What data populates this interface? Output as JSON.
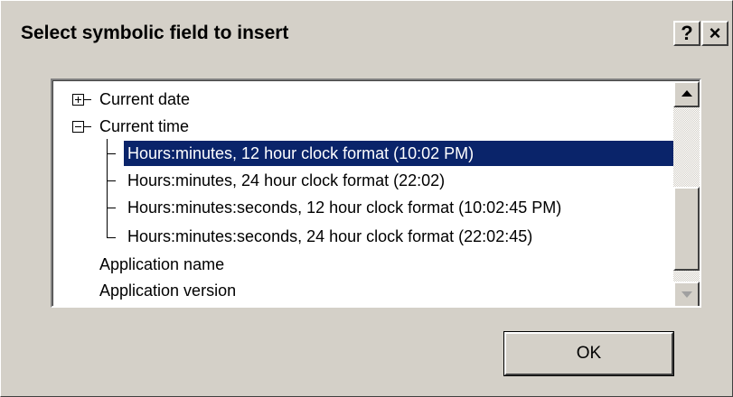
{
  "dialog": {
    "title": "Select symbolic field to insert",
    "help_button": "?",
    "close_button": "✕"
  },
  "tree": {
    "items": [
      {
        "label": "Current date",
        "expander": "plus"
      },
      {
        "label": "Current time",
        "expander": "minus"
      },
      {
        "label": "Hours:minutes, 12 hour clock format (10:02 PM)",
        "selected": true
      },
      {
        "label": "Hours:minutes, 24 hour clock format (22:02)"
      },
      {
        "label": "Hours:minutes:seconds, 12 hour clock format (10:02:45 PM)"
      },
      {
        "label": "Hours:minutes:seconds, 24 hour clock format (22:02:45)"
      },
      {
        "label": "Application name"
      },
      {
        "label": "Application version"
      }
    ]
  },
  "buttons": {
    "ok_label": "OK"
  },
  "colors": {
    "selection_bg": "#0a246a",
    "face": "#d4d0c8"
  }
}
